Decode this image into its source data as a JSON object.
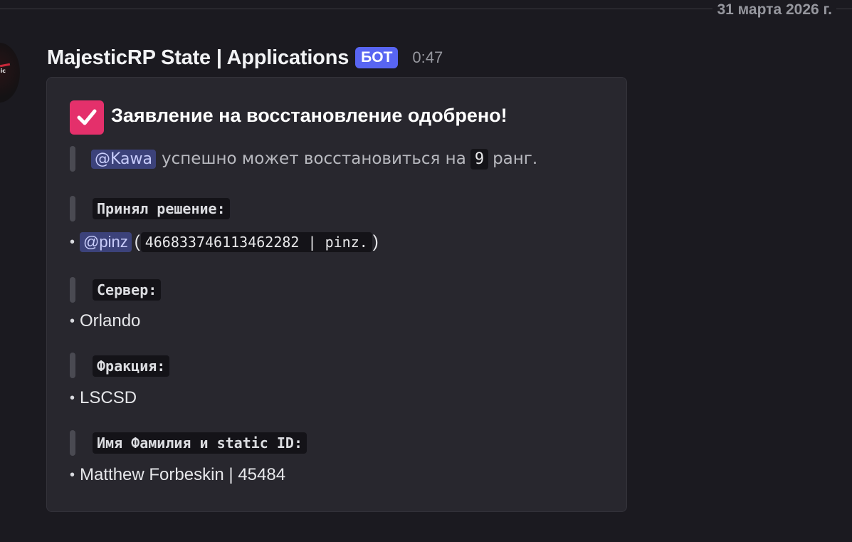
{
  "date_divider": "31 марта 2026 г.",
  "message": {
    "author": "MajesticRP State | Applications",
    "bot_tag": "БОТ",
    "time": "0:47",
    "avatar_text": "ic"
  },
  "embed": {
    "check_icon": "check-icon",
    "title": "Заявление на восстановление одобрено!",
    "description": {
      "mention": "@Kawa",
      "text_before": "успешно может восстановиться на",
      "rank": "9",
      "text_after": "ранг."
    },
    "fields": {
      "decider": {
        "label": "Принял решение:",
        "bullet": "•",
        "mention": "@pinz",
        "paren_open": "(",
        "code": "466833746113462282 | pinz.",
        "paren_close": ")"
      },
      "server": {
        "label": "Сервер:",
        "bullet": "•",
        "value": "Orlando"
      },
      "faction": {
        "label": "Фракция:",
        "bullet": "•",
        "value": "LSCSD"
      },
      "name": {
        "label": "Имя Фамилия и static ID:",
        "bullet": "•",
        "value": "Matthew Forbeskin | 45484"
      }
    }
  },
  "colors": {
    "background": "#1b1a20",
    "embed_bg": "#28272e",
    "bot_tag": "#5865f2",
    "check_icon": "#e4306b",
    "mention_bg": "#3c427a",
    "mention_text": "#c9cdfb"
  }
}
